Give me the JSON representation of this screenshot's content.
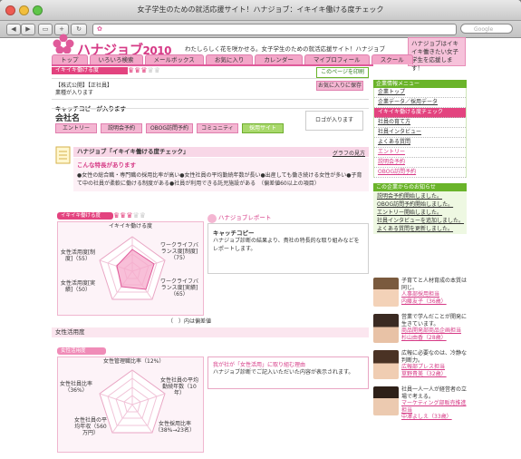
{
  "window": {
    "title": "女子学生のための就活応援サイト！ハナジョブ：イキイキ働ける度チェック"
  },
  "toolbar": {
    "back": "◀",
    "forward": "▶",
    "search_placeholder": "Google"
  },
  "site": {
    "logo": "ハナジョブ",
    "logo_year": "2010",
    "tagline": "わたしらしく花を咲かせる。女子学生のための就活応援サイト！ハナジョブ",
    "promo": "ハナジョブはイキイキ働きたい女子学生を応援します！"
  },
  "nav": [
    "トップ",
    "いろいろ検索",
    "メールボックス",
    "お気に入り",
    "カレンダー",
    "マイプロフィール",
    "スクール"
  ],
  "page_title": "イキイキ働ける度",
  "bookmark_page": "このページを印刷",
  "company": {
    "tags": "【株式公開】【正社員】",
    "industry": "業種が入ります",
    "favorite": "お気に入りに保存",
    "catchcopy": "キャッチコピーが入ります",
    "name": "会社名",
    "logo_placeholder": "ロゴが入ります",
    "buttons": [
      "エントリー",
      "説明会予約",
      "OBOG訪問予約",
      "コミュニティ",
      "採用サイト"
    ]
  },
  "check": {
    "heading": "ハナジョブ「イキイキ働ける度チェック」",
    "graph_link": "グラフの見方",
    "features_title": "こんな特長があります",
    "features_text": "●女性の総合職・専門職の採用比率が高い●女性社員の平均勤続年数が長い●出産しても働き続ける女性が多い●子育て中の社員が柔軟に働ける制度がある●社員が利用できる託児施設がある　（偏差値60以上の項目）"
  },
  "radar1": {
    "badge": "イキイキ働ける度",
    "labels": [
      "イキイキ働ける度",
      "ワークライフバランス度[制度]（75）",
      "ワークライフバランス度[実績]（65）",
      "女性活用度[実績]（50）",
      "女性活用度[制度]（55）"
    ],
    "note": "（　）内は偏差値"
  },
  "report": {
    "title": "ハナジョブレポート",
    "catch": "キャッチコピー",
    "body": "ハナジョブ診断の結果より、貴社の特長的な取り組みなどをレポートします。"
  },
  "women": {
    "section": "女性活用度",
    "badge": "女性活用度",
    "labels": [
      "女性管理職比率（12%）",
      "女性社員の平均勤続年数（10年）",
      "女性採用比率（38%→23名）",
      "女性社員の平均年収（560万円）",
      "女性社員比率（36%）"
    ],
    "reason_title": "我が社が「女性活用」に取り組む理由",
    "reason_body": "ハナジョブ診断でご記入いただいた内容が表示されます。"
  },
  "sidebar": {
    "menu_title": "企業情報メニュー",
    "menu": [
      "企業トップ",
      "企業データ／採用データ",
      "イキイキ働ける度チェック",
      "社員の育て方",
      "社員インタビュー",
      "よくある質問",
      "エントリー",
      "説明会予約",
      "OBOG訪問予約"
    ],
    "news_title": "この企業からのお知らせ",
    "news": [
      "説明会予約開始しました。",
      "OBOG訪問予約開始しました。",
      "エントリー開始しました。",
      "社員インタビューを追加しました。",
      "よくある質問を更新しました。"
    ],
    "interviews": [
      {
        "quote": "子育てと人材育成の本質は同じ。",
        "name": "人事部採用担当",
        "sub": "内藤友子（36歳）"
      },
      {
        "quote": "営業で学んだことが開発に生きています。",
        "name": "商品開発部商品企画担当",
        "sub": "杉山由香（28歳）"
      },
      {
        "quote": "広報に必要なのは、冷静な判断力。",
        "name": "広報部プレス担当",
        "sub": "草野貴美（32歳）"
      },
      {
        "quote": "社員一人一人が経営者の立場で考える。",
        "name": "マーケティング部販売推進担当",
        "sub": "中澤よしえ（33歳）"
      }
    ]
  },
  "colors": {
    "pink": "#e3437f",
    "light_pink": "#f8d7e7",
    "green": "#6ab42a"
  }
}
